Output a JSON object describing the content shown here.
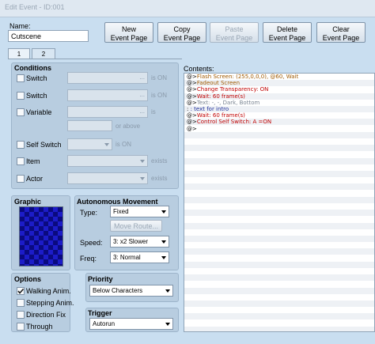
{
  "window": {
    "title": "Edit Event - ID:001"
  },
  "name": {
    "label": "Name:",
    "value": "Cutscene"
  },
  "toolbar": {
    "new": [
      "New",
      "Event Page"
    ],
    "copy": [
      "Copy",
      "Event Page"
    ],
    "paste": [
      "Paste",
      "Event Page"
    ],
    "delete": [
      "Delete",
      "Event Page"
    ],
    "clear": [
      "Clear",
      "Event Page"
    ]
  },
  "tabs": [
    "1",
    "2"
  ],
  "conditions": {
    "title": "Conditions",
    "switch1": {
      "label": "Switch",
      "suffix": "is ON",
      "ellipsis": "..."
    },
    "switch2": {
      "label": "Switch",
      "suffix": "is ON",
      "ellipsis": "..."
    },
    "variable": {
      "label": "Variable",
      "suffix": "is",
      "or_above": "or above",
      "ellipsis": "..."
    },
    "self_switch": {
      "label": "Self Switch",
      "suffix": "is ON"
    },
    "item": {
      "label": "Item",
      "suffix": "exists"
    },
    "actor": {
      "label": "Actor",
      "suffix": "exists"
    }
  },
  "graphic": {
    "title": "Graphic"
  },
  "autonomous": {
    "title": "Autonomous Movement",
    "type_label": "Type:",
    "type_value": "Fixed",
    "move_route": "Move Route...",
    "speed_label": "Speed:",
    "speed_value": "3: x2 Slower",
    "freq_label": "Freq:",
    "freq_value": "3: Normal"
  },
  "options": {
    "title": "Options",
    "walking": {
      "label": "Walking Anim.",
      "checked": true
    },
    "stepping": {
      "label": "Stepping Anim."
    },
    "direction_fix": {
      "label": "Direction Fix"
    },
    "through": {
      "label": "Through"
    }
  },
  "priority": {
    "title": "Priority",
    "value": "Below Characters"
  },
  "trigger": {
    "title": "Trigger",
    "value": "Autorun"
  },
  "contents": {
    "label": "Contents:",
    "commands": [
      {
        "prefix": "@>",
        "text": "Flash Screen: (255,0,0,0), @60, Wait",
        "color": "#a05a00"
      },
      {
        "prefix": "@>",
        "text": "Fadeout Screen",
        "color": "#a05a00"
      },
      {
        "prefix": "@>",
        "text": "Change Transparency: ON",
        "color": "#c00000"
      },
      {
        "prefix": "@>",
        "text": "Wait: 60 frame(s)",
        "color": "#c00000"
      },
      {
        "prefix": "@>",
        "text": "Text: -, -, Dark, Bottom",
        "color": "#7a8592"
      },
      {
        "prefix": " :",
        "text": "      : text for intro",
        "color": "#1e2f9a"
      },
      {
        "prefix": "@>",
        "text": "Wait: 60 frame(s)",
        "color": "#c00000"
      },
      {
        "prefix": "@>",
        "text": "Control Self Switch: A =ON",
        "color": "#c00000"
      },
      {
        "prefix": "@>",
        "text": "",
        "color": "#000000"
      }
    ]
  }
}
